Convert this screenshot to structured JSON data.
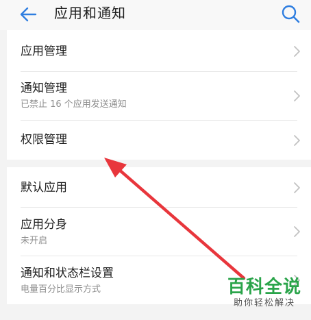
{
  "header": {
    "title": "应用和通知",
    "back_icon": "arrow-left-icon",
    "search_icon": "search-icon"
  },
  "sections": [
    {
      "items": [
        {
          "label": "应用管理",
          "subtitle": ""
        },
        {
          "label": "通知管理",
          "subtitle": "已禁止 16 个应用发送通知"
        },
        {
          "label": "权限管理",
          "subtitle": ""
        }
      ]
    },
    {
      "items": [
        {
          "label": "默认应用",
          "subtitle": ""
        },
        {
          "label": "应用分身",
          "subtitle": "未开启"
        },
        {
          "label": "通知和状态栏设置",
          "subtitle": "电量百分比显示方式"
        }
      ]
    }
  ],
  "watermark": {
    "title": "百科全说",
    "subtitle": "助你轻松解决"
  },
  "colors": {
    "accent": "#2f7ee0",
    "annotation_arrow": "#e8363c",
    "watermark_green": "#2aa44a",
    "background": "#f3f3f3"
  }
}
